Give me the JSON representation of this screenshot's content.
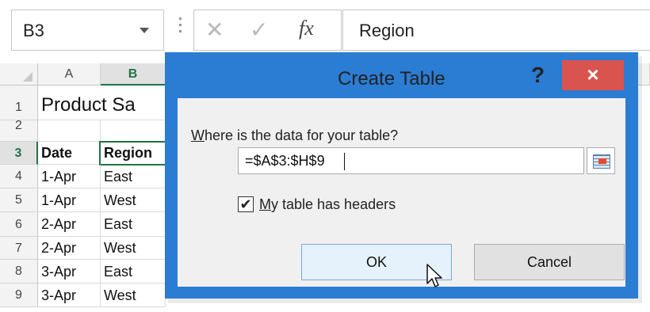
{
  "formula_bar": {
    "name_box": "B3",
    "fx_label": "fx",
    "formula": "Region"
  },
  "grid": {
    "columns": [
      "A",
      "B"
    ],
    "selected_column": "B",
    "row_numbers": [
      "1",
      "2",
      "3",
      "4",
      "5",
      "6",
      "7",
      "8",
      "9"
    ],
    "title": "Product Sa",
    "headers": [
      "Date",
      "Region"
    ],
    "rows": [
      [
        "1-Apr",
        "East"
      ],
      [
        "1-Apr",
        "West"
      ],
      [
        "2-Apr",
        "East"
      ],
      [
        "2-Apr",
        "West"
      ],
      [
        "3-Apr",
        "East"
      ],
      [
        "3-Apr",
        "West"
      ]
    ]
  },
  "dialog": {
    "title": "Create Table",
    "help": "?",
    "close": "×",
    "prompt_accel": "W",
    "prompt_rest": "here is the data for your table?",
    "range_value": "=$A$3:$H$9",
    "checkbox_checked": true,
    "checkbox_mark": "✔",
    "checkbox_accel": "M",
    "checkbox_rest": "y table has headers",
    "ok_label": "OK",
    "cancel_label": "Cancel"
  },
  "colors": {
    "accent_green": "#217346",
    "title_bar": "#2b7cd3",
    "close_button": "#d9534f"
  }
}
